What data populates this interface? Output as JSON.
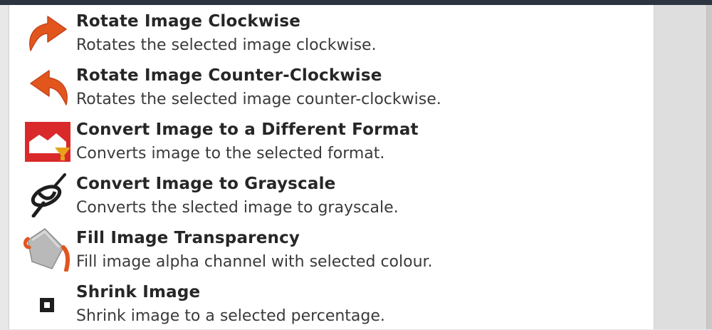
{
  "actions": [
    {
      "title": "Rotate Image Clockwise",
      "description": "Rotates the selected image clockwise.",
      "icon": "rotate-clockwise-icon"
    },
    {
      "title": "Rotate Image Counter-Clockwise",
      "description": "Rotates the selected image counter-clockwise.",
      "icon": "rotate-counter-clockwise-icon"
    },
    {
      "title": "Convert Image to a Different Format",
      "description": "Converts image to the selected format.",
      "icon": "convert-format-icon"
    },
    {
      "title": "Convert Image to Grayscale",
      "description": "Converts the slected image to grayscale.",
      "icon": "grayscale-icon"
    },
    {
      "title": "Fill Image Transparency",
      "description": "Fill image alpha channel with selected colour.",
      "icon": "fill-bucket-icon"
    },
    {
      "title": "Shrink Image",
      "description": "Shrink image to a selected percentage.",
      "icon": "shrink-icon"
    }
  ],
  "colors": {
    "accent_orange": "#e2561e",
    "format_red": "#d9292b",
    "list_bg": "#ffffff",
    "panel_bg": "#dedede"
  }
}
